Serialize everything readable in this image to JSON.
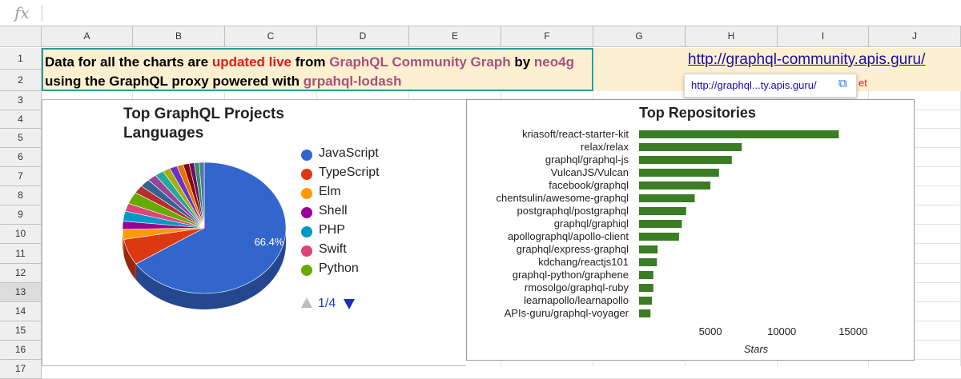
{
  "formula_bar": {
    "fx_label": "fx",
    "content": ""
  },
  "columns": [
    "A",
    "B",
    "C",
    "D",
    "E",
    "F",
    "G",
    "H",
    "I",
    "J"
  ],
  "rows": [
    "1",
    "2",
    "3",
    "4",
    "5",
    "6",
    "7",
    "8",
    "9",
    "10",
    "11",
    "12",
    "13",
    "14",
    "15",
    "16",
    "17"
  ],
  "active_row": "13",
  "banner": {
    "t1": "Data for all the charts are ",
    "t2": "updated live",
    "t3": " from ",
    "t4": "GraphQL Community Graph",
    "t5": " by ",
    "t6": "neo4g",
    "t7": " using the GraphQL proxy powered with ",
    "t8": "grpahql-lodash"
  },
  "link": {
    "text": "http://graphql-community.apis.guru/"
  },
  "tooltip": {
    "text": "http://graphql...ty.apis.guru/",
    "icon": "open-in-new-icon"
  },
  "partial_text": "et",
  "pie_chart": {
    "title_line1": "Top GraphQL Projects",
    "title_line2": "Languages",
    "slice_label": "66.4%",
    "legend": [
      {
        "label": "JavaScript",
        "color": "#3366cc"
      },
      {
        "label": "TypeScript",
        "color": "#dc3912"
      },
      {
        "label": "Elm",
        "color": "#ff9900"
      },
      {
        "label": "Shell",
        "color": "#990099"
      },
      {
        "label": "PHP",
        "color": "#0099c6"
      },
      {
        "label": "Swift",
        "color": "#dd4477"
      },
      {
        "label": "Python",
        "color": "#66aa00"
      }
    ],
    "pager": "1/4"
  },
  "chart_data": [
    {
      "type": "pie",
      "title": "Top GraphQL Projects Languages",
      "slices": [
        {
          "label": "JavaScript",
          "value": 66.4,
          "color": "#3366cc"
        },
        {
          "label": "TypeScript",
          "value": 6.5,
          "color": "#dc3912"
        },
        {
          "label": "Elm",
          "value": 2.5,
          "color": "#ff9900"
        },
        {
          "label": "Shell",
          "value": 2.0,
          "color": "#990099"
        },
        {
          "label": "PHP",
          "value": 2.5,
          "color": "#0099c6"
        },
        {
          "label": "Swift",
          "value": 2.0,
          "color": "#dd4477"
        },
        {
          "label": "Python",
          "value": 3.0,
          "color": "#66aa00"
        },
        {
          "label": "",
          "value": 2.0,
          "color": "#b82e2e"
        },
        {
          "label": "",
          "value": 2.0,
          "color": "#316395"
        },
        {
          "label": "",
          "value": 1.8,
          "color": "#994499"
        },
        {
          "label": "",
          "value": 1.8,
          "color": "#22aa99"
        },
        {
          "label": "",
          "value": 1.5,
          "color": "#aaaa11"
        },
        {
          "label": "",
          "value": 1.5,
          "color": "#6633cc"
        },
        {
          "label": "",
          "value": 1.3,
          "color": "#e67300"
        },
        {
          "label": "",
          "value": 1.2,
          "color": "#8b0707"
        },
        {
          "label": "",
          "value": 1.0,
          "color": "#651067"
        },
        {
          "label": "",
          "value": 1.0,
          "color": "#329262"
        },
        {
          "label": "",
          "value": 1.0,
          "color": "#5574a6"
        }
      ],
      "legend_position": "right"
    },
    {
      "type": "bar",
      "orientation": "horizontal",
      "title": "Top Repositories",
      "xlabel": "Stars",
      "categories": [
        "kriasoft/react-starter-kit",
        "relax/relax",
        "graphql/graphql-js",
        "VulcanJS/Vulcan",
        "facebook/graphql",
        "chentsulin/awesome-graphql",
        "postgraphql/postgraphql",
        "graphql/graphiql",
        "apollographql/apollo-client",
        "graphql/express-graphql",
        "kdchang/reactjs101",
        "graphql-python/graphene",
        "rmosolgo/graphql-ruby",
        "learnapollo/learnapollo",
        "APIs-guru/graphql-voyager"
      ],
      "values": [
        14000,
        7200,
        6500,
        5600,
        5000,
        3900,
        3300,
        3000,
        2800,
        1300,
        1250,
        1000,
        1000,
        900,
        800
      ],
      "xticks": [
        "5000",
        "10000",
        "15000"
      ],
      "xtick_values": [
        5000,
        10000,
        15000
      ],
      "xlim": [
        0,
        16500
      ],
      "bar_color": "#3a7d22",
      "grid": false
    }
  ]
}
